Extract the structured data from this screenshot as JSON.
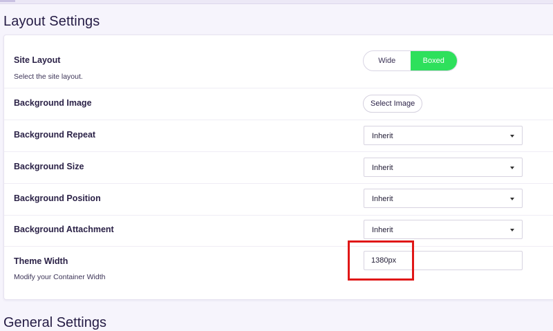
{
  "page": {
    "title": "Layout Settings",
    "next_section_title": "General Settings"
  },
  "settings": {
    "site_layout": {
      "label": "Site Layout",
      "description": "Select the site layout.",
      "options": [
        "Wide",
        "Boxed"
      ],
      "selected": "Boxed"
    },
    "background_image": {
      "label": "Background Image",
      "button_label": "Select Image"
    },
    "background_repeat": {
      "label": "Background Repeat",
      "value": "Inherit"
    },
    "background_size": {
      "label": "Background Size",
      "value": "Inherit"
    },
    "background_position": {
      "label": "Background Position",
      "value": "Inherit"
    },
    "background_attachment": {
      "label": "Background Attachment",
      "value": "Inherit"
    },
    "theme_width": {
      "label": "Theme Width",
      "description": "Modify your Container Width",
      "value": "1380px"
    }
  },
  "colors": {
    "toggle_active": "#2ee05c",
    "highlight": "#e01717",
    "heading": "#241b44"
  },
  "icons": {
    "dropdown": "caret-down-icon"
  }
}
